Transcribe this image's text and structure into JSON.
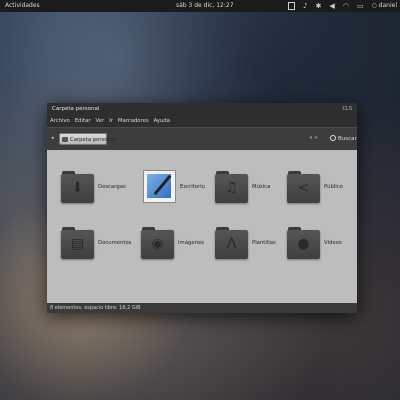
{
  "panel": {
    "activities": "Actividades",
    "clock": "sáb 3 de dic, 12:27",
    "user": "daniel"
  },
  "window": {
    "title": "Carpeta personal",
    "controls": "CLS",
    "menu": [
      "Archivo",
      "Editar",
      "Ver",
      "Ir",
      "Marcadores",
      "Ayuda"
    ],
    "breadcrumb": "Carpeta personal",
    "search_label": "Buscar",
    "status": "8 elementos, espacio libre: 16,2 GiB"
  },
  "items": [
    {
      "label": "Descargas",
      "icon": "download-icon"
    },
    {
      "label": "Escritorio",
      "icon": "desktop-icon"
    },
    {
      "label": "Música",
      "icon": "music-icon"
    },
    {
      "label": "Público",
      "icon": "share-icon"
    },
    {
      "label": "Documentos",
      "icon": "document-icon"
    },
    {
      "label": "Imágenes",
      "icon": "camera-icon"
    },
    {
      "label": "Plantillas",
      "icon": "compass-icon"
    },
    {
      "label": "Vídeos",
      "icon": "film-icon"
    }
  ]
}
